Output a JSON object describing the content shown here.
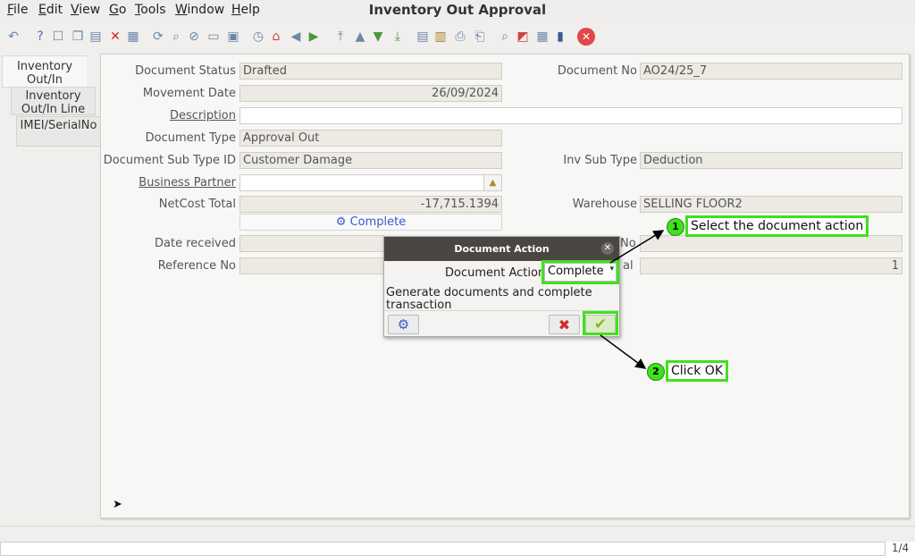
{
  "menu": [
    "File",
    "Edit",
    "View",
    "Go",
    "Tools",
    "Window",
    "Help"
  ],
  "window_title": "Inventory Out Approval",
  "tabs": [
    "Inventory Out/In",
    "Inventory Out/In Line",
    "IMEI/SerialNo"
  ],
  "form": {
    "document_status_label": "Document Status",
    "document_status": "Drafted",
    "document_no_label": "Document No",
    "document_no": "AO24/25_7",
    "movement_date_label": "Movement Date",
    "movement_date": "26/09/2024",
    "description_label": "Description",
    "description": "",
    "document_type_label": "Document Type",
    "document_type": "Approval Out",
    "document_sub_type_label": "Document Sub Type ID",
    "document_sub_type": "Customer Damage",
    "inv_sub_type_label": "Inv Sub Type",
    "inv_sub_type": "Deduction",
    "business_partner_label": "Business Partner",
    "business_partner": "",
    "netcost_total_label": "NetCost Total",
    "netcost_total": "-17,715.1394",
    "warehouse_label": "Warehouse",
    "warehouse": "SELLING FLOOR2",
    "complete_button": "Complete",
    "date_received_label": "Date received",
    "reference_no_label": "Reference No",
    "hidden_right_label_1": "No",
    "hidden_right_label_2": "al",
    "hidden_right_value_2": "1"
  },
  "dialog": {
    "title": "Document Action",
    "action_label": "Document Action",
    "action_value": "Complete",
    "description": "Generate documents and complete transaction"
  },
  "annotations": {
    "step1_badge": "1",
    "step1_text": "Select the document action",
    "step2_badge": "2",
    "step2_text": "Click OK"
  },
  "status": {
    "page_indicator": "1/4"
  },
  "colors": {
    "highlight": "#3ee21c",
    "dialog_title_bg": "#4a4642",
    "complete_link": "#3a5bcc"
  }
}
